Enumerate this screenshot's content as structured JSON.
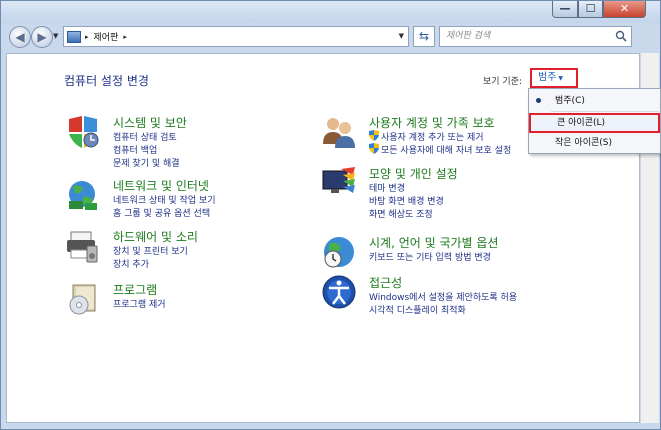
{
  "window": {
    "controls": {
      "minimize": "—",
      "maximize": "☐",
      "close": "✕"
    }
  },
  "navigation": {
    "back_glyph": "◀",
    "forward_glyph": "▶",
    "address_separator": "▸",
    "address_path": "제어판",
    "address_path_separator": "▸",
    "refresh_glyph": "⇆",
    "search_placeholder": "제어판 검색"
  },
  "header": {
    "page_title": "컴퓨터 설정 변경",
    "view_by_label": "보기 기준:",
    "view_by_value": "범주"
  },
  "categories_left": [
    {
      "title": "시스템 및 보안",
      "links": [
        "컴퓨터 상태 검토",
        "컴퓨터 백업",
        "문제 찾기 및 해결"
      ]
    },
    {
      "title": "네트워크 및 인터넷",
      "links": [
        "네트워크 상태 및 작업 보기",
        "홈 그룹 및 공유 옵션 선택"
      ]
    },
    {
      "title": "하드웨어 및 소리",
      "links": [
        "장치 및 프린터 보기",
        "장치 추가"
      ]
    },
    {
      "title": "프로그램",
      "links": [
        "프로그램 제거"
      ]
    }
  ],
  "categories_right": [
    {
      "title": "사용자 계정 및 가족 보호",
      "links": [
        "사용자 계정 추가 또는 제거",
        "모든 사용자에 대해 자녀 보호 설정"
      ]
    },
    {
      "title": "모양 및 개인 설정",
      "links": [
        "테마 변경",
        "바탕 화면 배경 변경",
        "화면 해상도 조정"
      ]
    },
    {
      "title": "시계, 언어 및 국가별 옵션",
      "links": [
        "키보드 또는 기타 입력 방법 변경"
      ]
    },
    {
      "title": "접근성",
      "links": [
        "Windows에서 설정을 제안하도록 허용",
        "시각적 디스플레이 최적화"
      ]
    }
  ],
  "view_menu": {
    "items": [
      "범주(C)",
      "큰 아이콘(L)",
      "작은 아이콘(S)"
    ],
    "checked_index": 0,
    "highlighted_index": 1
  },
  "colors": {
    "category_title": "#1d7a1d",
    "link": "#1e3287",
    "highlight_border": "#e0202a"
  }
}
